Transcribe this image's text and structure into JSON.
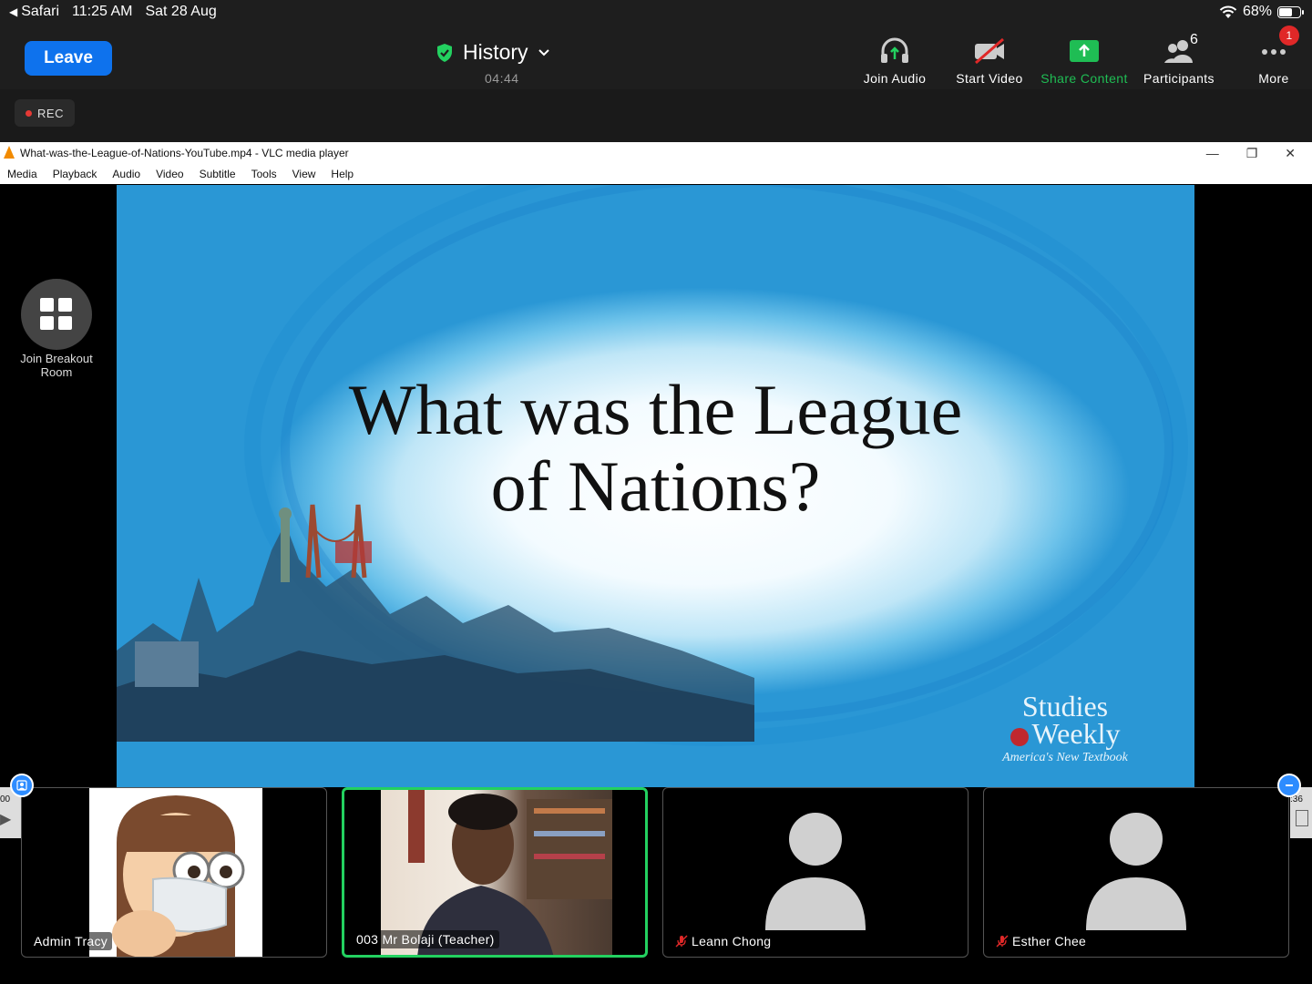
{
  "status_bar": {
    "back_app": "Safari",
    "time": "11:25 AM",
    "date": "Sat 28 Aug",
    "battery": "68%",
    "battery_level": 0.68
  },
  "meeting": {
    "leave_label": "Leave",
    "title": "History",
    "timer": "04:44",
    "rec_label": "REC"
  },
  "toolbar": {
    "join_audio": "Join Audio",
    "start_video": "Start Video",
    "share_content": "Share Content",
    "participants": "Participants",
    "participants_count": "6",
    "more": "More",
    "more_badge": "1"
  },
  "breakout": {
    "label": "Join Breakout Room"
  },
  "vlc": {
    "window_title": "What-was-the-League-of-Nations-YouTube.mp4 - VLC media player",
    "menu": [
      "Media",
      "Playback",
      "Audio",
      "Video",
      "Subtitle",
      "Tools",
      "View",
      "Help"
    ]
  },
  "slide": {
    "title_line1": "What was the League",
    "title_line2": "of Nations?",
    "brand_line1": "Studies",
    "brand_line2": "Weekly",
    "brand_tagline": "America's New Textbook"
  },
  "player": {
    "time_left": "00",
    "time_right": ":36"
  },
  "participants": [
    {
      "name": "Admin Tracy",
      "muted": false,
      "active": false,
      "kind": "memoji"
    },
    {
      "name": "003 Mr Bolaji (Teacher)",
      "muted": false,
      "active": true,
      "kind": "video"
    },
    {
      "name": "Leann Chong",
      "muted": true,
      "active": false,
      "kind": "placeholder"
    },
    {
      "name": "Esther Chee",
      "muted": true,
      "active": false,
      "kind": "placeholder"
    }
  ],
  "colors": {
    "leave": "#0e72ed",
    "share": "#1fbd54",
    "active_speaker": "#23d160",
    "rec_dot": "#e53935",
    "badge": "#e02828"
  }
}
